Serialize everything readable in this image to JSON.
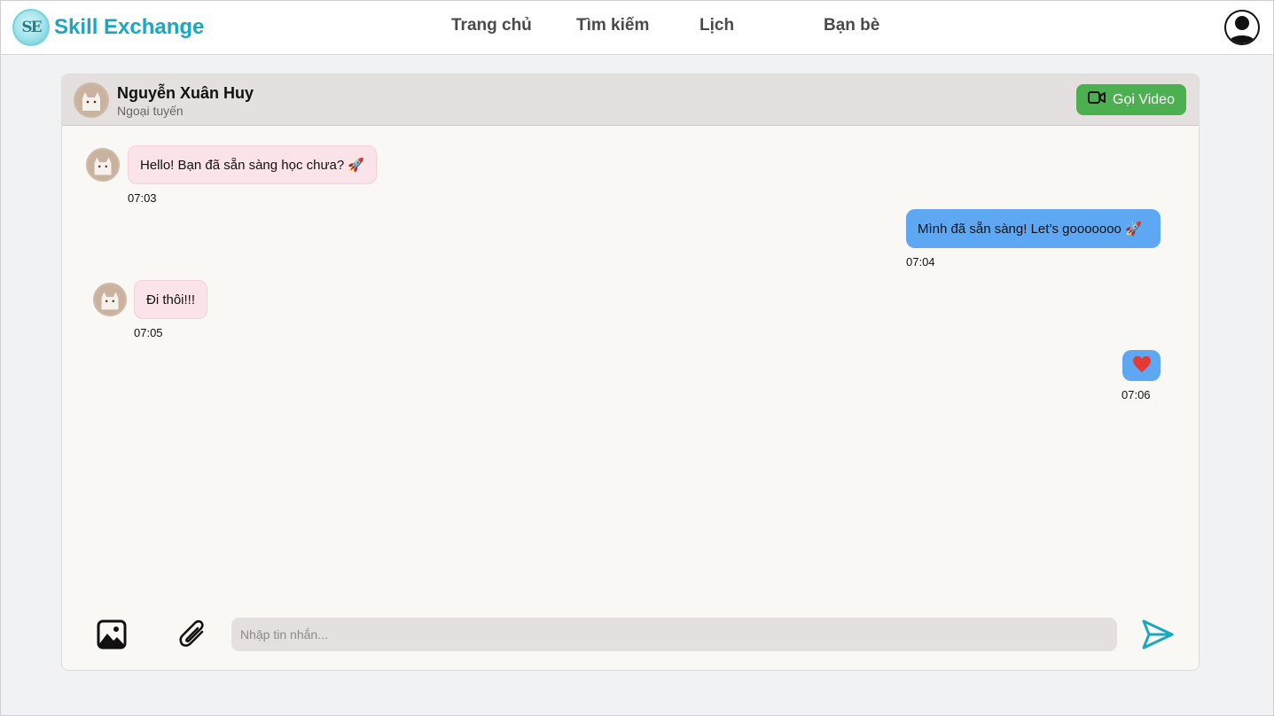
{
  "header": {
    "logo_text": "SE",
    "brand": "Skill Exchange",
    "nav": [
      {
        "label": "Trang chủ"
      },
      {
        "label": "Tìm kiếm"
      },
      {
        "label": "Lịch"
      },
      {
        "label": "Bạn bè"
      }
    ],
    "profile_icon": "user-avatar-icon"
  },
  "chat": {
    "contact_name": "Nguyễn Xuân Huy",
    "contact_status": "Ngoại tuyến",
    "video_call_label": "Gọi Video",
    "messages": [
      {
        "direction": "incoming",
        "text": "Hello! Bạn đã sẵn sàng học chưa? 🚀",
        "time": "07:03"
      },
      {
        "direction": "outgoing",
        "text": "Mình đã sẵn sàng! Let’s gooooooo 🚀",
        "time": "07:04"
      },
      {
        "direction": "incoming",
        "text": "Đi thôi!!!",
        "time": "07:05"
      },
      {
        "direction": "outgoing",
        "text": "",
        "icon": "heart-icon",
        "time": "07:06"
      }
    ],
    "composer": {
      "placeholder": "Nhập tin nhắn...",
      "image_icon": "image-icon",
      "attach_icon": "paperclip-icon",
      "send_icon": "send-icon"
    }
  },
  "colors": {
    "brand": "#1aa7c2",
    "video_button": "#4caf50",
    "incoming_bubble": "#fbe3ea",
    "outgoing_bubble": "#5ea7f3",
    "heart": "#e53935"
  }
}
